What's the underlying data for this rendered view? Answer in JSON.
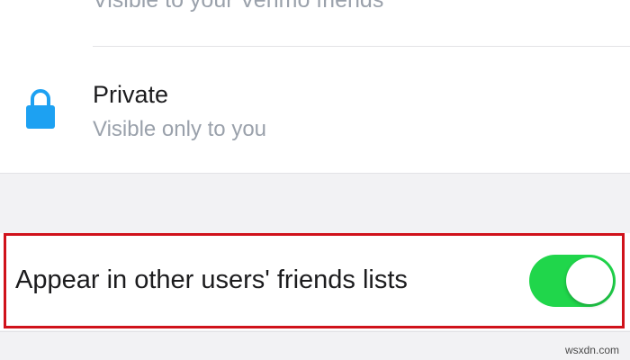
{
  "friends_option": {
    "subtitle": "Visible to your Venmo friends"
  },
  "private_option": {
    "icon": "lock-icon",
    "title": "Private",
    "subtitle": "Visible only to you"
  },
  "friends_list_setting": {
    "label": "Appear in other users' friends lists",
    "enabled": true
  },
  "colors": {
    "accent_blue": "#1da1f2",
    "toggle_on": "#20d64b",
    "highlight": "#d0121b"
  },
  "watermark": "wsxdn.com"
}
